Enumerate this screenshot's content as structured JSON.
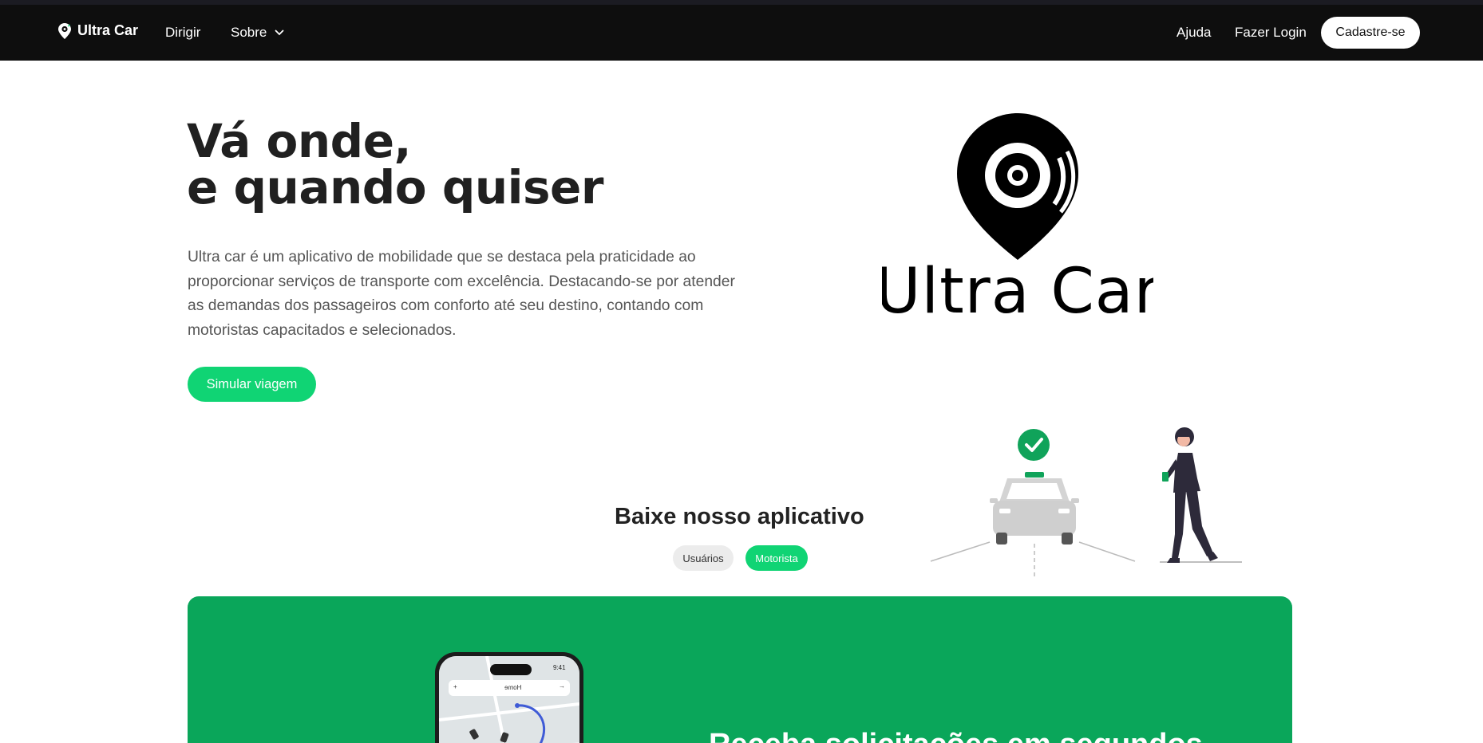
{
  "nav": {
    "brand": "Ultra Car",
    "links": {
      "dirigir": "Dirigir",
      "sobre": "Sobre",
      "ajuda": "Ajuda",
      "login": "Fazer Login"
    },
    "signup": "Cadastre-se"
  },
  "hero": {
    "title_line1": "Vá onde,",
    "title_line2": "e quando quiser",
    "description": "Ultra car é um aplicativo de mobilidade que se destaca pela praticidade ao proporcionar serviços de transporte com excelência. Destacando-se por atender as demandas dos passageiros com conforto até seu destino, contando com motoristas capacitados e selecionados.",
    "cta": "Simular viagem",
    "logo_text": "Ultra Car"
  },
  "download": {
    "title": "Baixe nosso aplicativo",
    "tabs": [
      "Usuários",
      "Motorista"
    ],
    "active_tab": "Motorista"
  },
  "banner": {
    "phone": {
      "time": "9:41",
      "search_label": "Home",
      "plus": "+",
      "arrow": "→"
    },
    "title": "Receba solicitações em segundos"
  },
  "colors": {
    "nav_bg": "#0e0e0e",
    "accent": "#10d474",
    "banner_green": "#0aa65a",
    "heading": "#202020",
    "body_text": "#555555"
  },
  "icons": [
    "location-pin-icon",
    "chevron-down-icon",
    "check-icon",
    "taxi-car-icon",
    "walking-woman-icon",
    "phone-mockup-icon"
  ]
}
